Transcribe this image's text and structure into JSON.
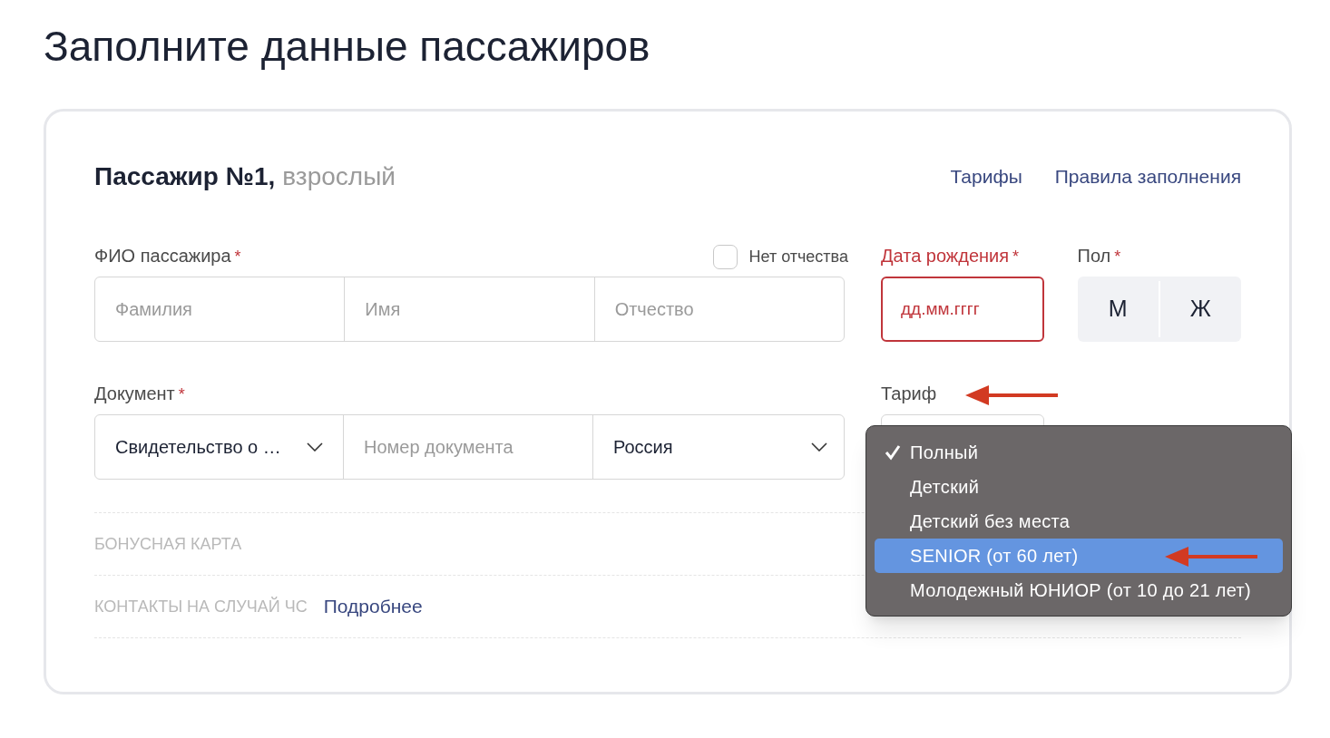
{
  "page_title": "Заполните данные пассажиров",
  "passenger": {
    "title": "Пассажир №1,",
    "subtitle": "взрослый",
    "links": [
      "Тарифы",
      "Правила заполнения"
    ]
  },
  "full_name": {
    "label": "ФИО пассажира",
    "required_mark": "*",
    "no_patronymic": {
      "label": "Нет отчества",
      "checked": false
    },
    "fields": [
      {
        "placeholder": "Фамилия"
      },
      {
        "placeholder": "Имя"
      },
      {
        "placeholder": "Отчество"
      }
    ]
  },
  "birth_date": {
    "label": "Дата рождения",
    "required_mark": "*",
    "placeholder": "дд.мм.гггг",
    "error": true
  },
  "gender": {
    "label": "Пол",
    "required_mark": "*",
    "options": [
      {
        "label": "М",
        "selected": false
      },
      {
        "label": "Ж",
        "selected": false
      }
    ]
  },
  "document": {
    "label": "Документ",
    "required_mark": "*",
    "type_value": "Свидетельство о …",
    "number_placeholder": "Номер документа",
    "country_value": "Россия"
  },
  "tariff": {
    "label": "Тариф",
    "menu": [
      {
        "label": "Полный",
        "checked": true,
        "selected": false
      },
      {
        "label": "Детский",
        "checked": false,
        "selected": false
      },
      {
        "label": "Детский без места",
        "checked": false,
        "selected": false
      },
      {
        "label": "SENIOR (от 60 лет)",
        "checked": false,
        "selected": true
      },
      {
        "label": "Молодежный ЮНИОР (от 10 до 21 лет)",
        "checked": false,
        "selected": false
      }
    ]
  },
  "sections": [
    {
      "label": "БОНУСНАЯ КАРТА"
    },
    {
      "label": "КОНТАКТЫ НА СЛУЧАЙ ЧС",
      "link": "Подробнее"
    }
  ]
}
